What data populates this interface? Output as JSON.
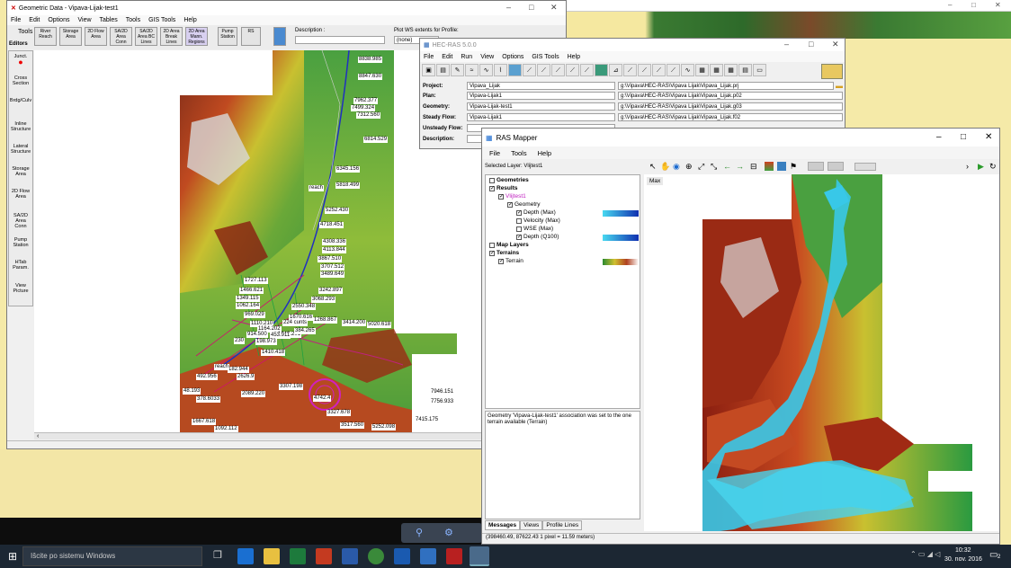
{
  "geometric": {
    "title": "Geometric Data - Vipava-Lijak-test1",
    "menu": [
      "File",
      "Edit",
      "Options",
      "View",
      "Tables",
      "Tools",
      "GIS Tools",
      "Help"
    ],
    "tools_label": "Tools",
    "editors_label": "Editors",
    "toolbar": [
      "River Reach",
      "Storage Area",
      "2D Flow Area",
      "SA/2D Area Conn",
      "SA/2D Area BC Lines",
      "2D Area Break Lines",
      "2D Area Mann. Regions",
      "Pump Station",
      "RS",
      "Plot WS"
    ],
    "description_label": "Description :",
    "plot_ws_label": "Plot WS extents for Profile:",
    "plot_ws_value": "(none)",
    "editors": [
      "Junct.",
      "Cross Section",
      "Brdg/Culv",
      "Inline Structure",
      "Lateral Structure",
      "Storage Area",
      "2D Flow Area",
      "SA/2D Area Conn",
      "Pump Station",
      "HTab Param.",
      "View Picture"
    ],
    "labels": [
      "8838.985",
      "8847.630",
      "7962.377",
      "7499.324",
      "7312.560",
      "6814.529",
      "6345.156",
      "5818.499",
      "5252.430",
      "4718.451",
      "4308.336",
      "4113.844",
      "3867.510",
      "3707.512",
      "3489.649",
      "3242.897",
      "3068.293",
      "2550.348",
      "1727.113",
      "1466.621",
      "1349.115",
      "1062.164",
      "969.029",
      "1670.616",
      "1268.867",
      "1110.210",
      "1164.202",
      "1049.201",
      "224 cunts",
      "914.500",
      "453.911",
      "384.265",
      "230",
      "198.973",
      "1410.418",
      "182.944",
      "492.956",
      "48.193",
      "378.6033",
      "2089.220",
      "3307.198",
      "2626.9",
      "5020.618",
      "3414.200",
      "1667.618",
      "1092.112",
      "3517.560",
      "5252.098",
      "7946.151",
      "7756.933",
      "7415.175",
      "4742.4",
      "3327.678",
      "reach",
      "reach"
    ],
    "hscroll_arrow": "‹"
  },
  "hecras": {
    "title": "HEC-RAS 5.0.0",
    "menu": [
      "File",
      "Edit",
      "Run",
      "View",
      "Options",
      "GIS Tools",
      "Help"
    ],
    "rows": [
      {
        "label": "Project:",
        "value": "Vipava_Lijak",
        "path": "g:\\Vipava\\HEC-RAS\\Vipava Lijak\\Vipava_Lijak.prj"
      },
      {
        "label": "Plan:",
        "value": "Vipava-Lijak1",
        "path": "g:\\Vipava\\HEC-RAS\\Vipava Lijak\\Vipava_Lijak.p02"
      },
      {
        "label": "Geometry:",
        "value": "Vipava-Lijak-test1",
        "path": "g:\\Vipava\\HEC-RAS\\Vipava Lijak\\Vipava_Lijak.g03"
      },
      {
        "label": "Steady Flow:",
        "value": "Vipava-Lijak1",
        "path": "g:\\Vipava\\HEC-RAS\\Vipava Lijak\\Vipava_Lijak.f02"
      },
      {
        "label": "Unsteady Flow:",
        "value": "",
        "path": ""
      },
      {
        "label": "Description:",
        "value": "",
        "path": ""
      }
    ]
  },
  "mapper": {
    "title": "RAS Mapper",
    "menu": [
      "File",
      "Tools",
      "Help"
    ],
    "selected_layer": "Selected Layer: Vlijtest1",
    "max_label": "Max",
    "tree": [
      {
        "label": "Geometries",
        "bold": true,
        "checked": false,
        "indent": 0
      },
      {
        "label": "Results",
        "bold": true,
        "checked": true,
        "indent": 0
      },
      {
        "label": "Vlijtest1",
        "bold": false,
        "checked": true,
        "indent": 1
      },
      {
        "label": "Geometry",
        "bold": false,
        "checked": true,
        "indent": 2
      },
      {
        "label": "Depth (Max)",
        "bold": false,
        "checked": true,
        "indent": 3
      },
      {
        "label": "Velocity (Max)",
        "bold": false,
        "checked": false,
        "indent": 3
      },
      {
        "label": "WSE (Max)",
        "bold": false,
        "checked": false,
        "indent": 3
      },
      {
        "label": "Depth (Q100)",
        "bold": false,
        "checked": true,
        "indent": 3
      },
      {
        "label": "Map Layers",
        "bold": true,
        "checked": false,
        "indent": 0
      },
      {
        "label": "Terrains",
        "bold": true,
        "checked": true,
        "indent": 0
      },
      {
        "label": "Terrain",
        "bold": false,
        "checked": true,
        "indent": 1
      }
    ],
    "message": "Geometry 'Vipava-Lijak-test1' association was set to the one terrain available (Terrain)",
    "tabs": [
      "Messages",
      "Views",
      "Profile Lines"
    ],
    "status": "(398460.49, 87622.43  1 pixel = 11.59 meters)"
  },
  "behind_window_controls": [
    "–",
    "□",
    "✕"
  ],
  "taskbar": {
    "search_placeholder": "Išcite po sistemu Windows",
    "time": "10:32",
    "date": "30. nov. 2016",
    "notif_count": "2"
  },
  "colors": {
    "terrain_low": "#4a9a3a",
    "terrain_mid": "#c9c030",
    "terrain_high": "#8a1e10",
    "water": "#38c8e8",
    "taskbar": "#1c2733"
  }
}
